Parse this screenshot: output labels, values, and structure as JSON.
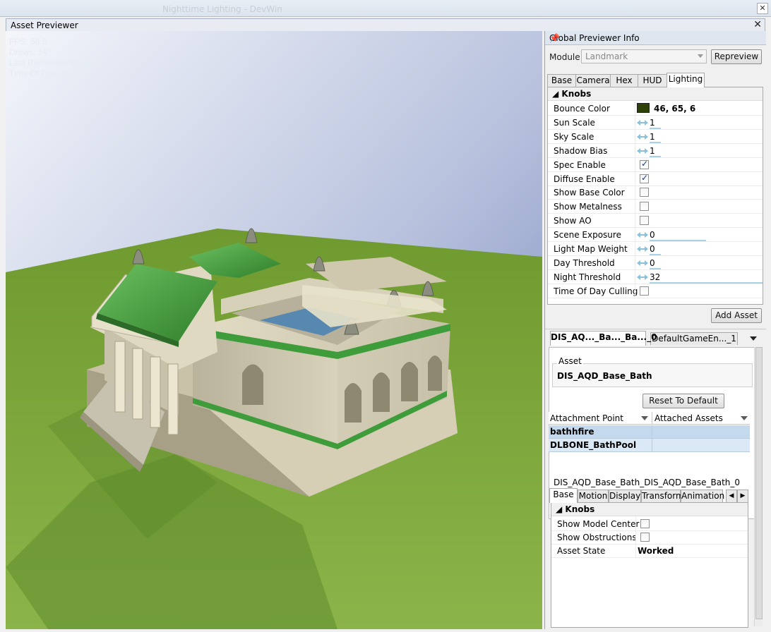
{
  "background_title": "Nighttime Lighting - DevWin",
  "window": {
    "title": "Asset Previewer",
    "close": "✕"
  },
  "hud": {
    "fps": "FPS: 58.8",
    "draws": "Draws: 14",
    "last_refreshed": "Last Refreshed At: 5:06:38 pm",
    "time_of_day": "Time Of Day: Day"
  },
  "global_panel": {
    "title": "Global Previewer Info",
    "module_label": "Module:",
    "module_value": "Landmark",
    "repreview_label": "Repreview",
    "tabs": [
      "Base",
      "Camera",
      "Hex",
      "HUD",
      "Lighting"
    ],
    "active_tab": "Lighting",
    "knobs_header": "Knobs",
    "rows": [
      {
        "name": "Bounce Color",
        "type": "color",
        "value": "46, 65, 6",
        "color": "#2e4106"
      },
      {
        "name": "Sun Scale",
        "type": "slider",
        "value": "1",
        "fraction": 0.08
      },
      {
        "name": "Sky Scale",
        "type": "slider",
        "value": "1",
        "fraction": 0.08
      },
      {
        "name": "Shadow Bias",
        "type": "slider",
        "value": "1",
        "fraction": 0.08
      },
      {
        "name": "Spec Enable",
        "type": "check",
        "checked": true
      },
      {
        "name": "Diffuse Enable",
        "type": "check",
        "checked": true
      },
      {
        "name": "Show Base Color",
        "type": "check",
        "checked": false
      },
      {
        "name": "Show Metalness",
        "type": "check",
        "checked": false
      },
      {
        "name": "Show AO",
        "type": "check",
        "checked": false
      },
      {
        "name": "Scene Exposure",
        "type": "slider",
        "value": "0",
        "fraction": 0.5
      },
      {
        "name": "Light Map Weight",
        "type": "slider",
        "value": "0",
        "fraction": 0
      },
      {
        "name": "Day Threshold",
        "type": "slider",
        "value": "0",
        "fraction": 0
      },
      {
        "name": "Night Threshold",
        "type": "slider",
        "value": "32",
        "fraction": 1.0
      },
      {
        "name": "Time Of Day Culling",
        "type": "check",
        "checked": false
      }
    ],
    "add_asset_label": "Add Asset"
  },
  "asset_panel": {
    "doc_tabs": [
      "DIS_AQ..._Ba..._Ba..._0",
      "DefaultGameEn..._1"
    ],
    "asset_group_label": "Asset",
    "asset_name": "DIS_AQD_Base_Bath",
    "reset_label": "Reset To Default",
    "grid_headers": [
      "Attachment Point",
      "Attached Assets"
    ],
    "grid_rows": [
      {
        "point": "bathhfire",
        "assets": ""
      },
      {
        "point": "DLBONE_BathPool",
        "assets": ""
      }
    ],
    "instance_name": "DIS_AQD_Base_Bath_DIS_AQD_Base_Bath_0",
    "sub_tabs": [
      "Base",
      "Motion",
      "Display",
      "Transform",
      "Animation"
    ],
    "knobs_header": "Knobs",
    "props": [
      {
        "name": "Show Model Center",
        "type": "check",
        "checked": false
      },
      {
        "name": "Show Obstructions",
        "type": "check",
        "checked": false
      },
      {
        "name": "Asset State",
        "type": "text",
        "value": "Worked"
      }
    ]
  },
  "colors": {
    "sky_top": "#f1f4fa",
    "sky_bottom": "#7d8dbc",
    "ground": "#7fa83e",
    "roof_green": "#3f9c3a",
    "stone": "#d9d3bd",
    "selected_row": "#c5d9ee",
    "bounce_color": "#2e4106"
  }
}
